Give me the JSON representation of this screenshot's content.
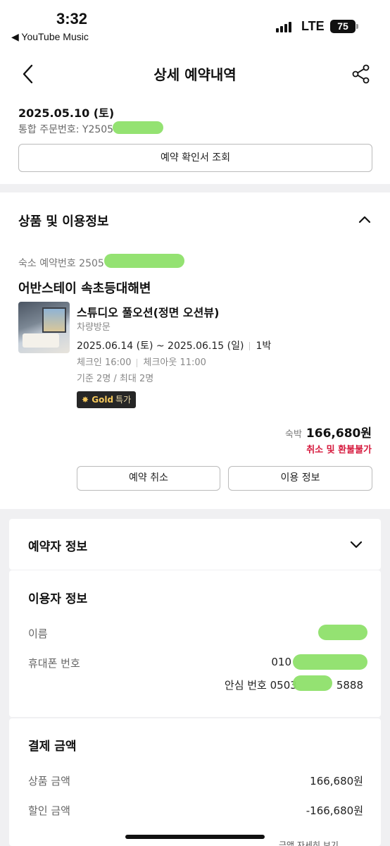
{
  "status_bar": {
    "time": "3:32",
    "back_app": "◀ YouTube Music",
    "network": "LTE",
    "battery": "75"
  },
  "header": {
    "title": "상세 예약내역",
    "back_icon": "chevron-left-icon",
    "share_icon": "share-icon"
  },
  "summary": {
    "date": "2025.05.10 (토)",
    "order_no": "통합 주문번호: Y2505",
    "confirm_button": "예약 확인서 조회"
  },
  "product": {
    "section_title": "상품 및 이용정보",
    "accommodation_no": "숙소 예약번호 2505",
    "hotel_name": "어반스테이 속초등대해변",
    "room_name": "스튜디오 풀오션(정면 오션뷰)",
    "visit_type": "차량방문",
    "stay_dates": "2025.06.14 (토) ~ 2025.06.15 (일)",
    "nights": "1박",
    "checkin": "체크인 16:00",
    "checkout": "체크아웃 11:00",
    "capacity": "기준 2명 / 최대 2명",
    "badge_brand": "Gold",
    "badge_text": "특가",
    "price_unit": "숙박",
    "price": "166,680원",
    "refund_policy": "취소 및 환불불가",
    "cancel_button": "예약 취소",
    "info_button": "이용 정보"
  },
  "booker": {
    "section_title": "예약자 정보"
  },
  "user": {
    "section_title": "이용자 정보",
    "name_label": "이름",
    "phone_label": "휴대폰 번호",
    "phone_value": "010",
    "safe_no_prefix": "안심 번호 0503",
    "safe_no_suffix": "5888"
  },
  "payment": {
    "section_title": "결제 금액",
    "product_amount_label": "상품 금액",
    "product_amount": "166,680원",
    "discount_label": "할인 금액",
    "discount_amount": "-166,680원",
    "detail_link": "금액 자세히 보기"
  },
  "colors": {
    "accent_red": "#d6193d",
    "gold_badge_bg": "#262626",
    "gold_badge_text": "#f5c85b",
    "section_gap": "#f0f0f2"
  }
}
